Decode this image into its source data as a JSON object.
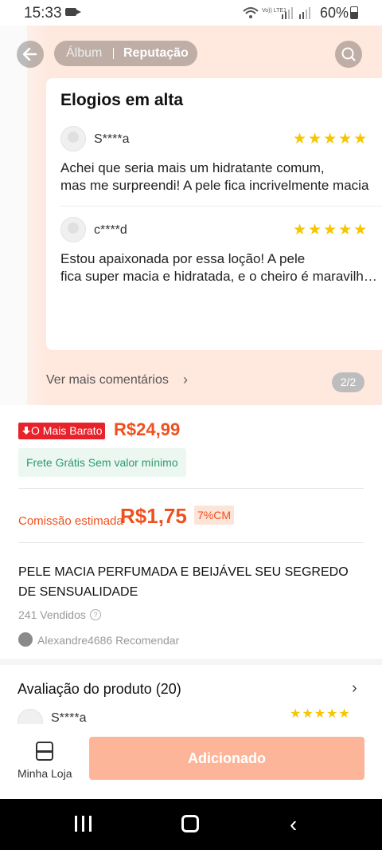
{
  "status_bar": {
    "time": "15:33",
    "network_label": "Vo)) LTE1",
    "battery": "60%"
  },
  "header": {
    "tabs": [
      "Álbum",
      "Reputação"
    ],
    "active_tab": "Reputação",
    "back_icon": "arrow-left-icon",
    "search_icon": "search-icon"
  },
  "review_card": {
    "title": "Elogios em alta",
    "reviews": [
      {
        "user": "S****a",
        "stars": "★★★★★",
        "line1": "Achei que seria mais um hidratante comum,",
        "line2": "mas me surpreendi! A pele fica incrivelmente macia"
      },
      {
        "user": "c****d",
        "stars": "★★★★★",
        "line1": "Estou apaixonada por essa loção! A pele",
        "line2": "fica super macia e hidratada, e o cheiro é maravilhoso"
      }
    ],
    "more_comments": "Ver mais comentários",
    "page_indicator": "2/2"
  },
  "price": {
    "badge": "O Mais Barato",
    "value": "R$24,99",
    "shipping": "Frete Grátis Sem valor mínimo"
  },
  "commission": {
    "label": "Comissão estimada",
    "value": "R$1,75",
    "percent": "7%CM"
  },
  "product": {
    "title": "PELE MACIA PERFUMADA E BEIJÁVEL SEU SEGREDO DE SENSUALIDADE",
    "sold": "241 Vendidos",
    "recommender": "Alexandre4686 Recomendar"
  },
  "rating": {
    "title": "Avaliação do produto (20)",
    "first_user": "S****a",
    "stars": "★★★★★"
  },
  "bottom_bar": {
    "store_label": "Minha Loja",
    "added_button": "Adicionado"
  },
  "colors": {
    "accent": "#f0501e",
    "badge_red": "#e8222a",
    "star": "#f7c600",
    "button_disabled": "#fdb59a"
  }
}
